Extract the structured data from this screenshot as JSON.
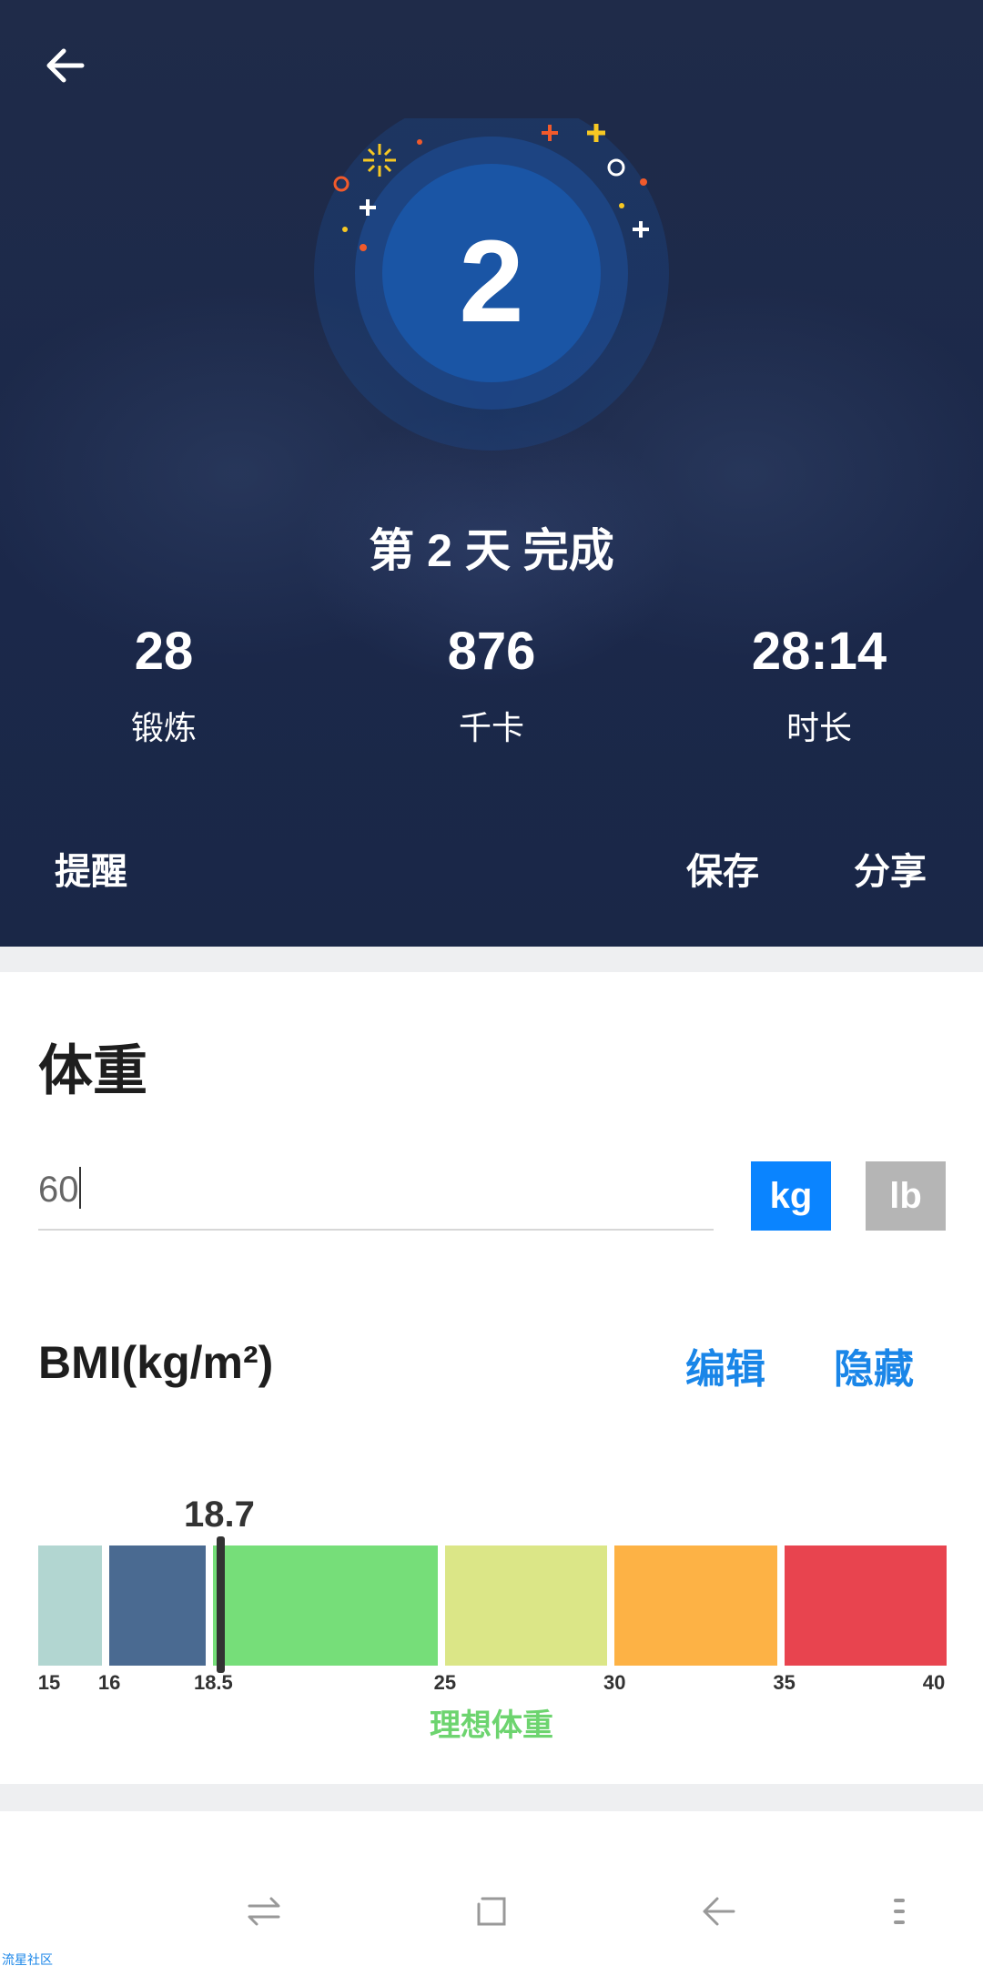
{
  "header": {
    "day_number": "2",
    "done_title": "第 2 天 完成",
    "stats": [
      {
        "value": "28",
        "label": "锻炼"
      },
      {
        "value": "876",
        "label": "千卡"
      },
      {
        "value": "28:14",
        "label": "时长"
      }
    ],
    "actions": {
      "remind": "提醒",
      "save": "保存",
      "share": "分享"
    }
  },
  "weight": {
    "title": "体重",
    "value": "60",
    "unit_kg": "kg",
    "unit_lb": "lb",
    "selected_unit": "kg"
  },
  "bmi": {
    "title": "BMI(kg/m²)",
    "edit": "编辑",
    "hide": "隐藏",
    "value": "18.7",
    "value_num": 18.7,
    "ticks": [
      "15",
      "16",
      "18.5",
      "25",
      "30",
      "35",
      "40"
    ],
    "segments": [
      {
        "from": 15,
        "to": 16,
        "color": "#b2d6d1"
      },
      {
        "from": 16,
        "to": 18.5,
        "color": "#4a6a91"
      },
      {
        "from": 18.5,
        "to": 25,
        "color": "#76de79"
      },
      {
        "from": 25,
        "to": 30,
        "color": "#dbe687"
      },
      {
        "from": 30,
        "to": 35,
        "color": "#fdb245"
      },
      {
        "from": 35,
        "to": 40,
        "color": "#e8444f"
      }
    ],
    "ideal_label": "理想体重"
  },
  "watermark": "流星社区",
  "colors": {
    "accent": "#0a84ff",
    "header_bg": "#1d2a4a",
    "ideal": "#6dd46f"
  }
}
